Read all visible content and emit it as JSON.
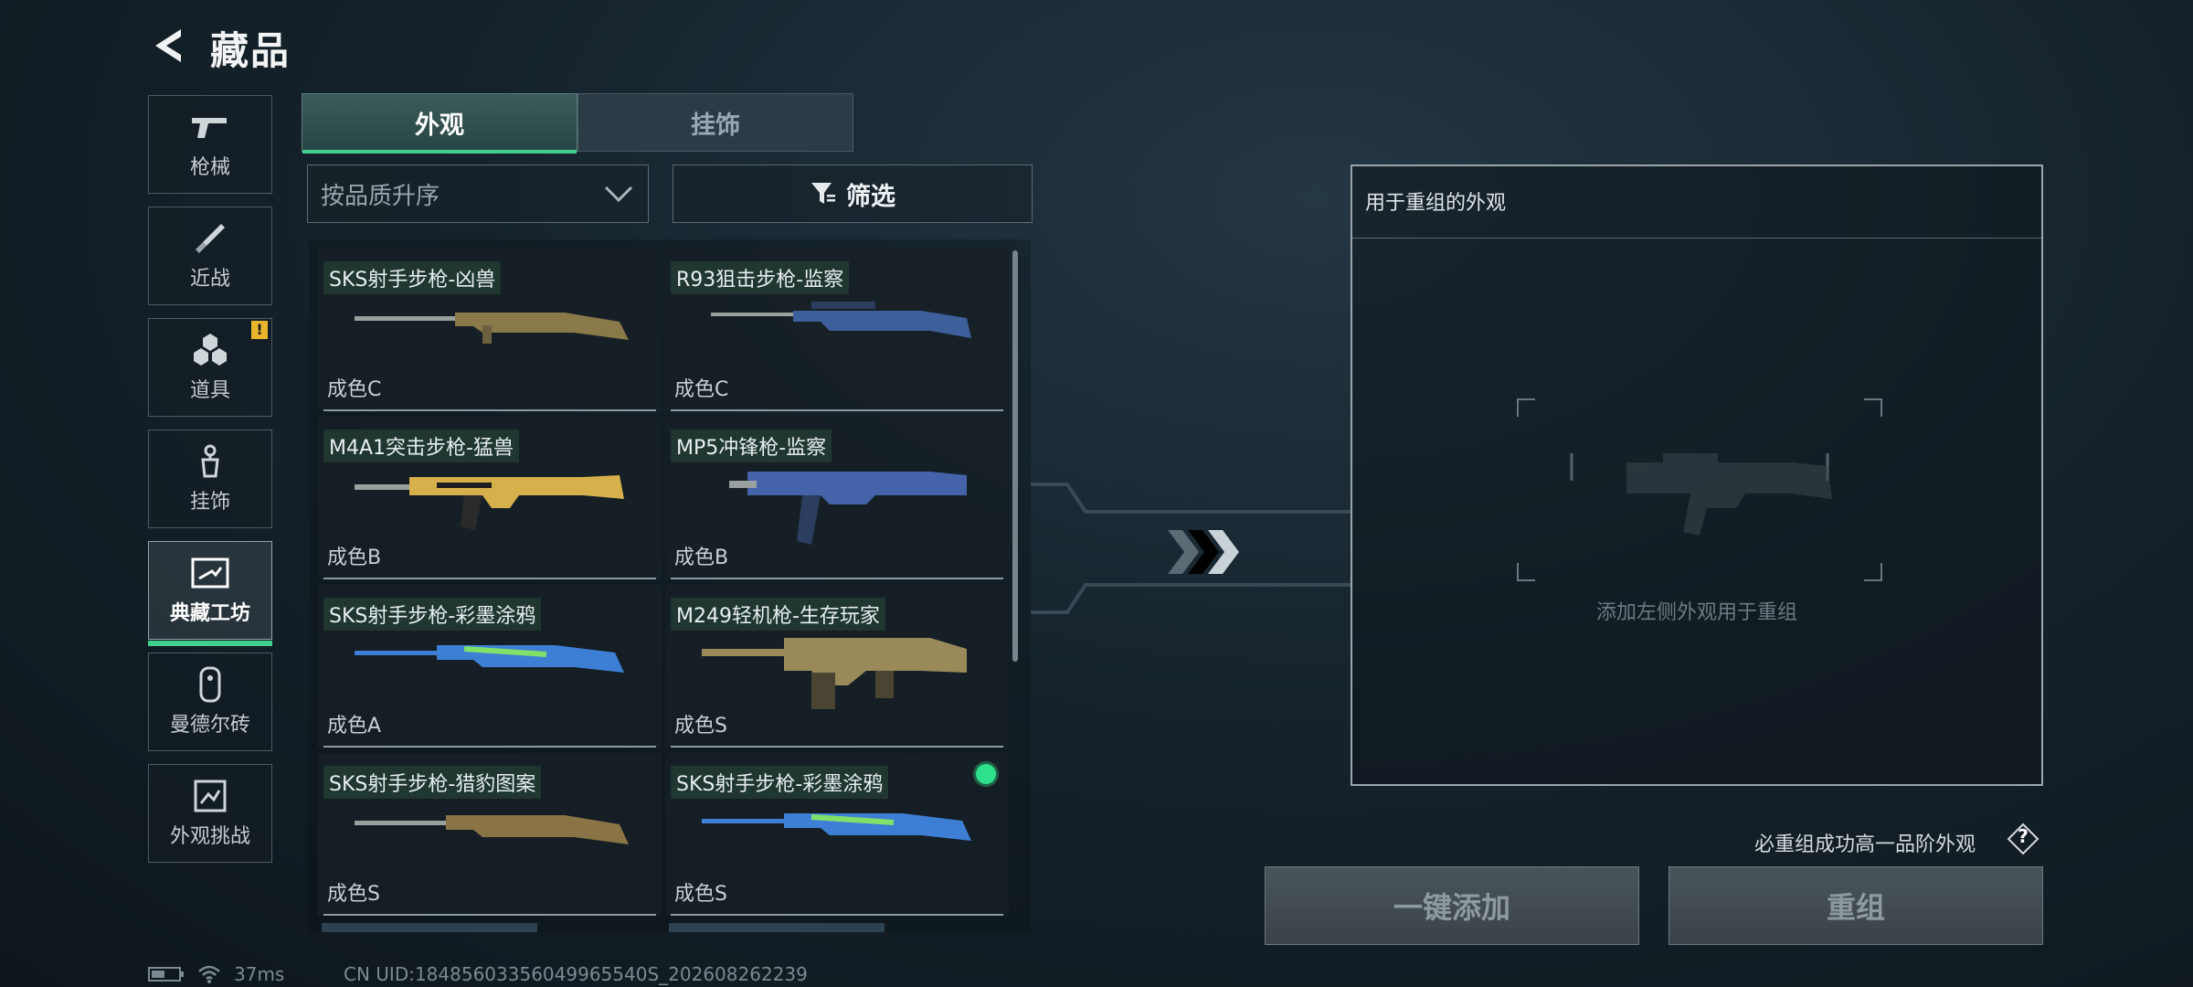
{
  "header": {
    "title": "藏品"
  },
  "sidebar": {
    "items": [
      {
        "label": "枪械",
        "icon": "gun-icon"
      },
      {
        "label": "近战",
        "icon": "knife-icon"
      },
      {
        "label": "道具",
        "icon": "items-icon",
        "badge": "!"
      },
      {
        "label": "挂饰",
        "icon": "pendant-icon"
      },
      {
        "label": "典藏工坊",
        "icon": "workshop-icon",
        "active": true
      },
      {
        "label": "曼德尔砖",
        "icon": "mandel-brick-icon"
      },
      {
        "label": "外观挑战",
        "icon": "challenge-icon"
      }
    ]
  },
  "tabs": [
    {
      "label": "外观",
      "active": true
    },
    {
      "label": "挂饰",
      "active": false
    }
  ],
  "sort": {
    "value": "按品质升序"
  },
  "filter": {
    "label": "筛选"
  },
  "items": [
    {
      "name": "SKS射手步枪-凶兽",
      "quality": "成色C",
      "color": "#8a7a4a"
    },
    {
      "name": "R93狙击步枪-监察",
      "quality": "成色C",
      "color": "#3d5f9a"
    },
    {
      "name": "M4A1突击步枪-猛兽",
      "quality": "成色B",
      "color": "#d6b04a"
    },
    {
      "name": "MP5冲锋枪-监察",
      "quality": "成色B",
      "color": "#4463a8"
    },
    {
      "name": "SKS射手步枪-彩墨涂鸦",
      "quality": "成色A",
      "color": "#3e7fd6"
    },
    {
      "name": "M249轻机枪-生存玩家",
      "quality": "成色S",
      "color": "#9a8a5a"
    },
    {
      "name": "SKS射手步枪-猎豹图案",
      "quality": "成色S",
      "color": "#8a7445"
    },
    {
      "name": "SKS射手步枪-彩墨涂鸦",
      "quality": "成色S",
      "color": "#3e7fd6",
      "selected": true
    }
  ],
  "reforge": {
    "title": "用于重组的外观",
    "hint": "添加左侧外观用于重组",
    "guarantee_note": "必重组成功高一品阶外观",
    "help_label": "?",
    "add_all_label": "一键添加",
    "reforge_label": "重组"
  },
  "status": {
    "ping": "37ms",
    "uid": "CN UID:18485603356049965540S_202608262239"
  },
  "colors": {
    "accent": "#3fcf8e",
    "badge": "#e8b62c"
  }
}
